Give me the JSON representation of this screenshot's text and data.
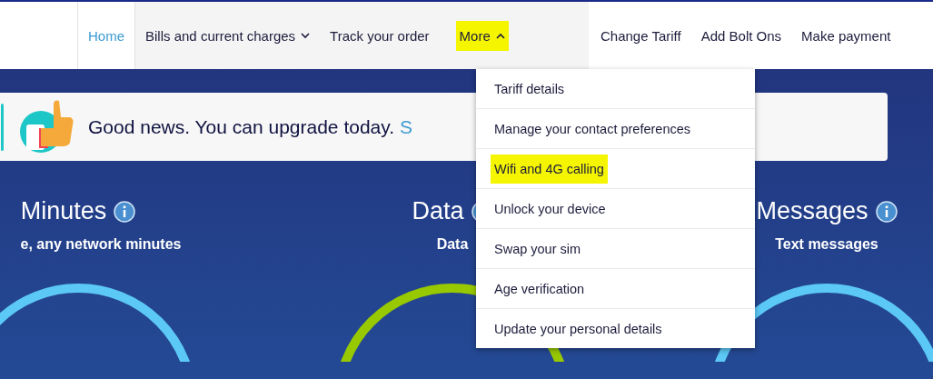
{
  "nav": {
    "items": [
      {
        "label": "Home",
        "selected": true,
        "highlighted": false
      },
      {
        "label": "Bills and current charges",
        "selected": false,
        "expanded": false,
        "highlighted": false
      },
      {
        "label": "Track your order",
        "selected": false,
        "highlighted": false
      },
      {
        "label": "More",
        "selected": false,
        "expanded": true,
        "highlighted": true
      }
    ],
    "quick_links": [
      "Change Tariff",
      "Add Bolt Ons",
      "Make payment"
    ]
  },
  "banner": {
    "text": "Good news. You can upgrade today.",
    "link": "S"
  },
  "allowances": [
    {
      "title": "Minutes",
      "subtitle": "e, any network minutes",
      "color": "#5bc8f5"
    },
    {
      "title": "Data",
      "subtitle": "Data",
      "color": "#97c800"
    },
    {
      "title": "Messages",
      "subtitle": "Text messages",
      "color": "#5bc8f5"
    }
  ],
  "more_menu": [
    {
      "label": "Tariff details",
      "highlighted": false
    },
    {
      "label": "Manage your contact preferences",
      "highlighted": false
    },
    {
      "label": "Wifi and 4G calling",
      "highlighted": true
    },
    {
      "label": "Unlock your device",
      "highlighted": false
    },
    {
      "label": "Swap your sim",
      "highlighted": false
    },
    {
      "label": "Age verification",
      "highlighted": false
    },
    {
      "label": "Update your personal details",
      "highlighted": false
    }
  ]
}
